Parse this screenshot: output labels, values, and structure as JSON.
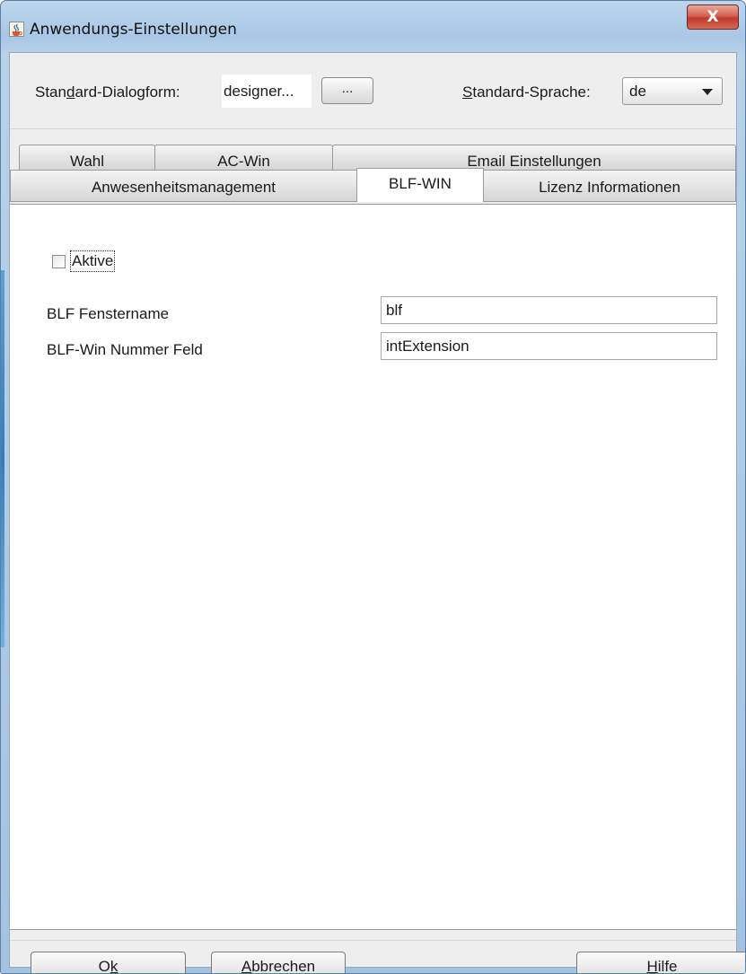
{
  "window": {
    "title": "Anwendungs-Einstellungen",
    "close_label": "X",
    "icon": "java-cup-icon"
  },
  "top": {
    "dialog_label_pre": "Stan",
    "dialog_label_mnemonic": "d",
    "dialog_label_post": "ard-Dialogform:",
    "dialog_value": "designer...",
    "browse_label": "...",
    "language_label_mnemonic": "S",
    "language_label_post": "tandard-Sprache:",
    "language_value": "de"
  },
  "tabs": {
    "row1": [
      "Wahl",
      "AC-Win",
      "Email Einstellungen"
    ],
    "row2": [
      "Anwesenheitsmanagement",
      "BLF-WIN",
      "Lizenz Informationen"
    ],
    "active": "BLF-WIN"
  },
  "panel": {
    "checkbox_label": "Aktive",
    "checkbox_checked": false,
    "fields": [
      {
        "label": "BLF Fenstername",
        "value": "blf"
      },
      {
        "label": "BLF-Win Nummer Feld",
        "value": "intExtension"
      }
    ]
  },
  "buttons": {
    "ok_pre": "O",
    "ok_mnemonic": "k",
    "cancel_mnemonic": "A",
    "cancel_post": "bbrechen",
    "help_mnemonic": "H",
    "help_post": "ilfe"
  },
  "colors": {
    "titlebar": "#a9c7e6",
    "close": "#c0392b",
    "dialog_bg": "#eeeeee",
    "panel_bg": "#ffffff"
  }
}
